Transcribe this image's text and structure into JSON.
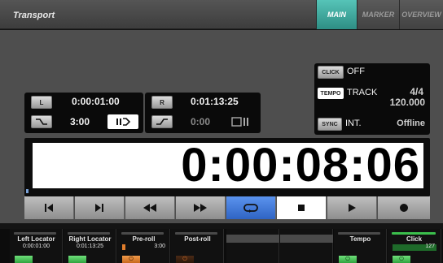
{
  "header": {
    "title": "Transport",
    "tabs": [
      {
        "label": "MAIN",
        "active": true
      },
      {
        "label": "MARKER",
        "active": false
      },
      {
        "label": "OVERVIEW",
        "active": false
      }
    ]
  },
  "left_locator": {
    "button": "L",
    "time": "0:00:01:00",
    "value": "3:00"
  },
  "right_locator": {
    "button": "R",
    "time": "0:01:13:25",
    "value": "0:00"
  },
  "info": {
    "click_label": "CLICK",
    "click_value": "OFF",
    "tempo_label": "TEMPO",
    "tempo_mode": "TRACK",
    "signature": "4/4",
    "tempo_value": "120.000",
    "sync_label": "SYNC",
    "sync_source": "INT.",
    "sync_status": "Offline"
  },
  "display": {
    "time": "0:00:08:06"
  },
  "transport": {
    "buttons": [
      "go-to-start",
      "go-to-end",
      "rewind",
      "fast-forward",
      "cycle",
      "stop",
      "play",
      "record"
    ]
  },
  "strips": [
    {
      "label": "Left Locator",
      "value": "0:00:01:00"
    },
    {
      "label": "Right Locator",
      "value": "0:01:13:25"
    },
    {
      "label": "Pre-roll",
      "value": "3:00"
    },
    {
      "label": "Post-roll",
      "value": ""
    },
    {
      "label": "",
      "value": ""
    },
    {
      "label": "",
      "value": ""
    },
    {
      "label": "Tempo",
      "value": ""
    },
    {
      "label": "Click",
      "value": "127"
    }
  ],
  "colors": {
    "accent_tab": "#3aa89c",
    "cycle_active": "#3a74d6",
    "green": "#4cc65a",
    "orange": "#e07d2c"
  }
}
